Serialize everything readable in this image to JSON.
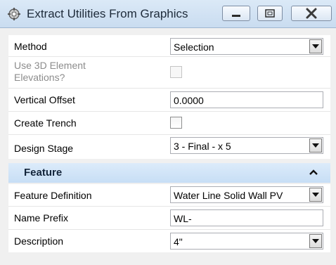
{
  "window": {
    "title": "Extract Utilities From Graphics"
  },
  "general": {
    "method_label": "Method",
    "method_value": "Selection",
    "elev_label_line1": "Use 3D Element",
    "elev_label_line2": "Elevations?",
    "vertical_offset_label": "Vertical Offset",
    "vertical_offset_value": "0.0000",
    "create_trench_label": "Create Trench",
    "design_stage_label": "Design Stage",
    "design_stage_value": "3 - Final - x 5"
  },
  "feature": {
    "section_title": "Feature",
    "definition_label": "Feature Definition",
    "definition_value": "Water Line Solid Wall PV",
    "name_prefix_label": "Name Prefix",
    "name_prefix_value": "WL-",
    "description_label": "Description",
    "description_value": "4\""
  },
  "icons": {
    "app": "gear-hand-icon",
    "minimize": "minimize-icon",
    "maximize": "maximize-icon",
    "close": "close-icon",
    "dropdown": "chevron-down-icon",
    "collapse": "chevron-up-icon"
  }
}
